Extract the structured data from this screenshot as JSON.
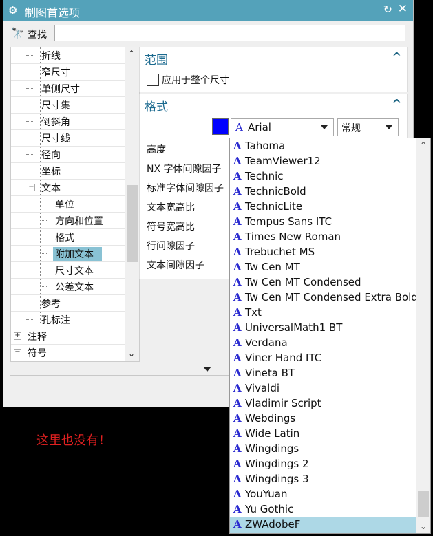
{
  "window": {
    "title": "制图首选项",
    "gear_icon": "⚙",
    "reset_icon": "↻",
    "close_icon": "✕"
  },
  "search": {
    "label": "查找",
    "value": "",
    "icon": "binoculars-icon"
  },
  "tree": {
    "items": [
      {
        "label": "折线",
        "level": 2
      },
      {
        "label": "窄尺寸",
        "level": 2
      },
      {
        "label": "单侧尺寸",
        "level": 2
      },
      {
        "label": "尺寸集",
        "level": 2
      },
      {
        "label": "倒斜角",
        "level": 2
      },
      {
        "label": "尺寸线",
        "level": 2
      },
      {
        "label": "径向",
        "level": 2
      },
      {
        "label": "坐标",
        "level": 2
      },
      {
        "label": "文本",
        "level": 2,
        "toggle": "−"
      },
      {
        "label": "单位",
        "level": 3
      },
      {
        "label": "方向和位置",
        "level": 3
      },
      {
        "label": "格式",
        "level": 3
      },
      {
        "label": "附加文本",
        "level": 3,
        "selected": true
      },
      {
        "label": "尺寸文本",
        "level": 3
      },
      {
        "label": "公差文本",
        "level": 3
      },
      {
        "label": "参考",
        "level": 2
      },
      {
        "label": "孔标注",
        "level": 2
      },
      {
        "label": "注释",
        "level": 1,
        "toggle": "+"
      },
      {
        "label": "符号",
        "level": 1,
        "toggle": "−"
      }
    ]
  },
  "scope_panel": {
    "title": "范围",
    "checkbox_label": "应用于整个尺寸",
    "checked": false
  },
  "format_panel": {
    "title": "格式",
    "color": "#0000ff",
    "font_value": "Arial",
    "style_value": "常规",
    "fields": [
      "高度",
      "NX 字体间隙因子",
      "标准字体间隙因子",
      "文本宽高比",
      "符号宽高比",
      "行间隙因子",
      "文本间隙因子"
    ]
  },
  "font_dropdown": {
    "options": [
      "Tahoma",
      "TeamViewer12",
      "Technic",
      "TechnicBold",
      "TechnicLite",
      "Tempus Sans ITC",
      "Times New Roman",
      "Trebuchet MS",
      "Tw Cen MT",
      "Tw Cen MT Condensed",
      "Tw Cen MT Condensed Extra Bold",
      "Txt",
      "UniversalMath1 BT",
      "Verdana",
      "Viner Hand ITC",
      "Vineta BT",
      "Vivaldi",
      "Vladimir Script",
      "Webdings",
      "Wide Latin",
      "Wingdings",
      "Wingdings 2",
      "Wingdings 3",
      "YouYuan",
      "Yu Gothic",
      "ZWAdobeF"
    ],
    "selected": "ZWAdobeF",
    "scroll_position": 0.95
  },
  "annotation": {
    "text": "这里也没有！",
    "color": "#e02020"
  }
}
